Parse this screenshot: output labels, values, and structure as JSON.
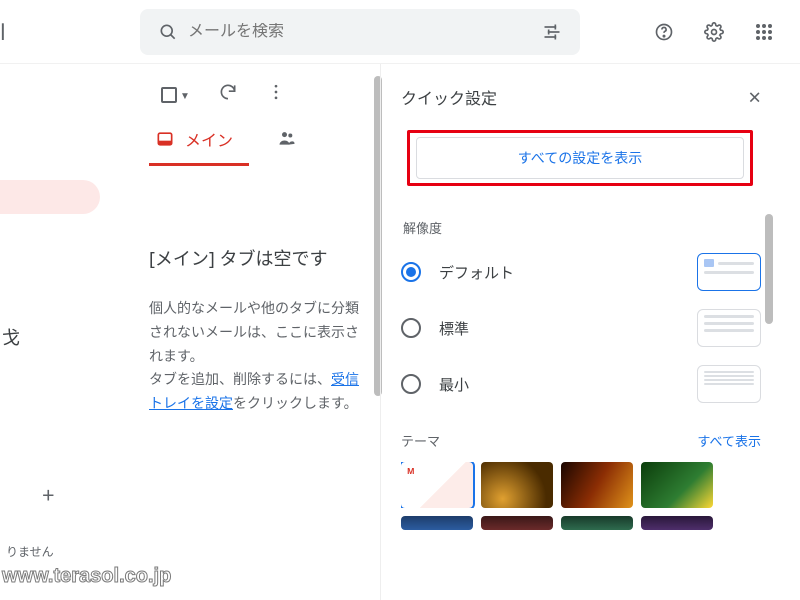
{
  "header": {
    "logo_fragment": "ail",
    "search_placeholder": "メールを検索"
  },
  "mail": {
    "tab_main": "メイン",
    "empty_heading": "[メイン] タブは空です",
    "empty_p1a": "個人的なメールや他のタブに分類されないメールは、ここに表示されます。",
    "empty_p2a": "タブを追加、削除するには、",
    "empty_link": "受信トレイを設定",
    "empty_p2b": "をクリックします。"
  },
  "left": {
    "char": "戈",
    "plus": "+",
    "bottom_line1": "りません"
  },
  "settings": {
    "title": "クイック設定",
    "all_settings": "すべての設定を表示",
    "density_label": "解像度",
    "density_default": "デフォルト",
    "density_comfortable": "標準",
    "density_compact": "最小",
    "theme_label": "テーマ",
    "theme_all": "すべて表示"
  },
  "watermark": "www.terasol.co.jp"
}
